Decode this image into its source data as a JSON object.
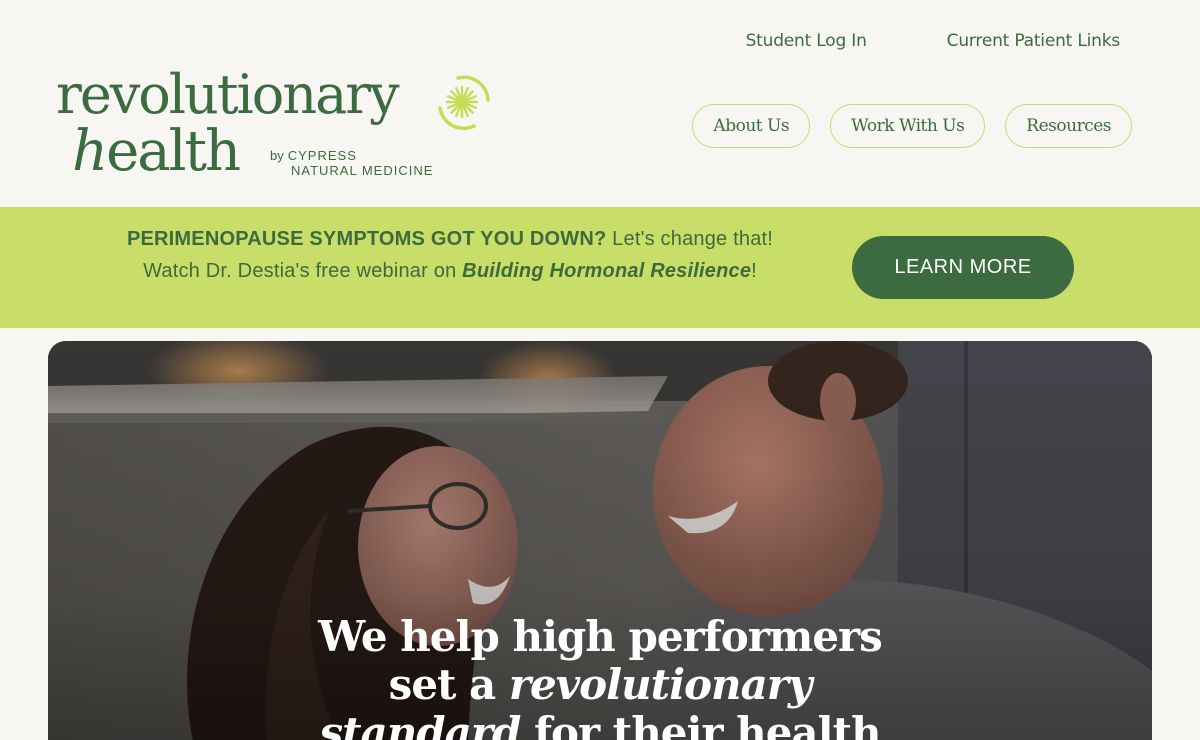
{
  "colors": {
    "brand_green": "#3c6b3f",
    "banner_lime": "#c8de68",
    "pill_border": "#c6dc73",
    "page_bg": "#f7f6f2"
  },
  "logo": {
    "line1": "revolutionary",
    "line2_italic": "h",
    "line2_rest": "ealth",
    "sub_by": "by",
    "sub_line1": "CYPRESS",
    "sub_line2": "NATURAL MEDICINE",
    "icon": "sun-icon"
  },
  "top_links": {
    "student_login": "Student Log In",
    "patient_links": "Current Patient Links"
  },
  "nav": {
    "about": "About Us",
    "work": "Work With Us",
    "resources": "Resources"
  },
  "banner": {
    "headline": "PERIMENOPAUSE SYMPTOMS GOT YOU DOWN?",
    "headline_tail": "Let's change that!",
    "line2_prefix": "Watch Dr. Destia's free webinar on",
    "webinar_title": "Building Hormonal Resilience",
    "line2_suffix": "!",
    "cta_label": "LEARN MORE"
  },
  "hero": {
    "line1": "We help high performers",
    "line2_prefix": "set a",
    "line2_italic": "revolutionary",
    "line3_italic": "standard",
    "line3_rest": "for their health"
  }
}
